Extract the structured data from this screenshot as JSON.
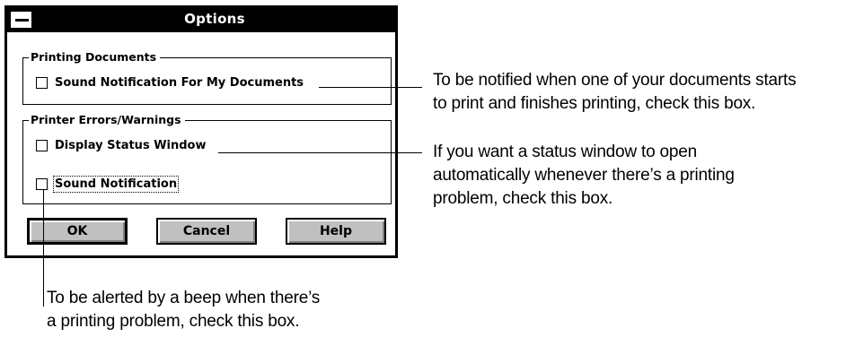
{
  "dialog": {
    "title": "Options",
    "group_printing": {
      "label": "Printing Documents",
      "checkbox_sound_docs": "Sound Notification For My Documents"
    },
    "group_errors": {
      "label": "Printer Errors/Warnings",
      "checkbox_display_status": "Display Status Window",
      "checkbox_sound": "Sound Notification"
    },
    "buttons": {
      "ok": "OK",
      "cancel": "Cancel",
      "help": "Help"
    }
  },
  "callouts": {
    "sound_docs": {
      "line1": "To be notified when one of your documents starts",
      "line2": "to print and finishes printing, check this box."
    },
    "display_status": {
      "line1": "If you want a status window to open",
      "line2": "automatically whenever there’s a printing",
      "line3": "problem, check this box."
    },
    "sound": {
      "line1": "To be alerted by a beep when there’s",
      "line2": "a printing problem, check this box."
    }
  }
}
